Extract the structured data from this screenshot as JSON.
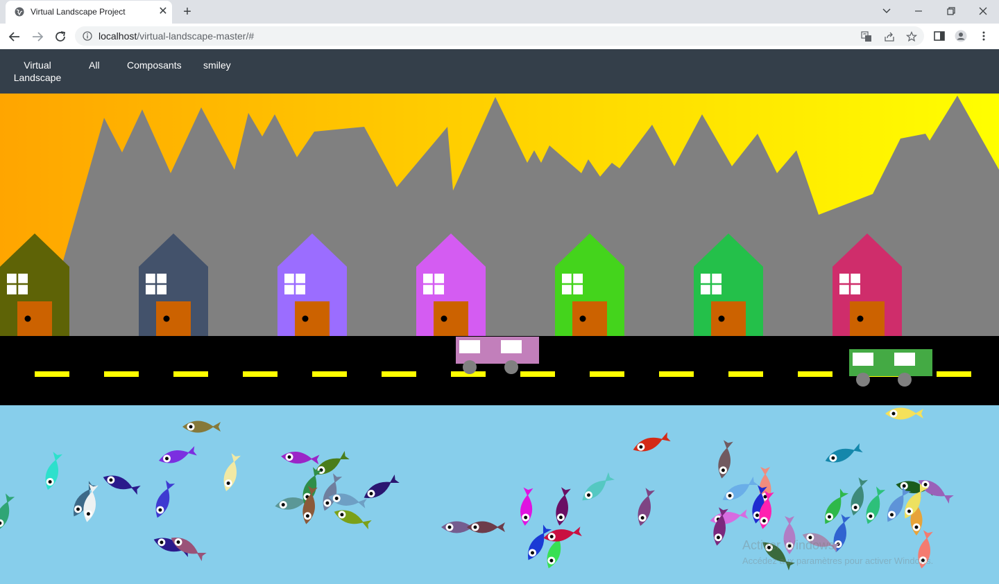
{
  "browser": {
    "tab_title": "Virtual Landscape Project",
    "new_tab": "+",
    "close": "✕",
    "url_host": "localhost",
    "url_path": "/virtual-landscape-master/#",
    "icons": [
      "back-arrow-icon",
      "forward-arrow-icon",
      "reload-icon",
      "info-icon",
      "translate-icon",
      "share-icon",
      "bookmark-star-icon",
      "side-panel-icon",
      "profile-icon",
      "kebab-menu-icon",
      "minimize-icon",
      "restore-icon",
      "close-window-icon",
      "tab-search-icon"
    ]
  },
  "nav": {
    "brand_line1": "Virtual",
    "brand_line2": "Landscape",
    "links": [
      "All",
      "Composants",
      "smiley"
    ],
    "background": "#343f4a"
  },
  "scene": {
    "sky_gradient": [
      "#ffa500",
      "#ffff00"
    ],
    "mountain_color": "#808080",
    "road_color": "#000000",
    "lane_color": "#ffff00",
    "water_color": "#87ceeb",
    "house_count": 7,
    "house_colors": [
      "#5e6306",
      "#43526b",
      "#9b6dff",
      "#d45cf2",
      "#44d41c",
      "#24c04a",
      "#cf2d6b"
    ],
    "door_color": "#cc6200",
    "vehicles": [
      {
        "name": "pink-van",
        "color": "#c27fbb"
      },
      {
        "name": "green-van",
        "color": "#44aa44"
      }
    ],
    "fish_count": 64
  },
  "watermark": {
    "title": "Activer Windows",
    "subtitle": "Accédez aux paramètres pour activer Windows."
  }
}
